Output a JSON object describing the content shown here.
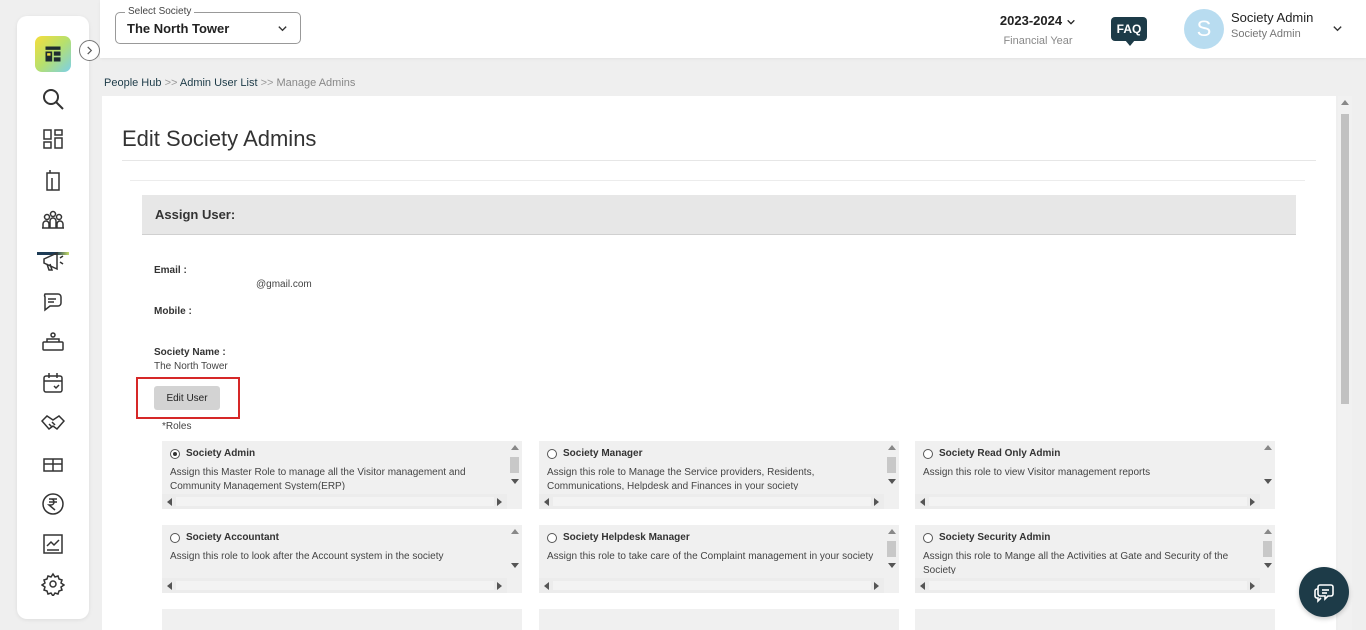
{
  "sidebar": {
    "nav_items": [
      "search-icon",
      "dashboard-icon",
      "building-icon",
      "people-icon",
      "megaphone-icon",
      "chat-icon",
      "amenity-icon",
      "calendar-icon",
      "handshake-icon",
      "gift-icon",
      "rupee-icon",
      "report-icon",
      "gear-icon"
    ],
    "active_item": "people-icon"
  },
  "header": {
    "society_select_label": "Select Society",
    "society_select_value": "The North Tower",
    "financial_year": "2023-2024",
    "financial_year_label": "Financial Year",
    "faq_label": "FAQ",
    "avatar_initial": "S",
    "user_name": "Society Admin",
    "user_role": "Society Admin"
  },
  "breadcrumb": {
    "item1": "People Hub",
    "item2": "Admin User List",
    "current": "Manage Admins",
    "separator": ">>"
  },
  "main": {
    "title": "Edit Society Admins",
    "section_title": "Assign User:",
    "email_label": "Email :",
    "email_value": "@gmail.com",
    "mobile_label": "Mobile :",
    "society_name_label": "Society Name :",
    "society_name_value": "The North Tower",
    "edit_user_label": "Edit User",
    "roles_label": "*Roles",
    "roles": [
      {
        "title": "Society Admin",
        "desc": "Assign this Master Role to manage all the Visitor management and Community Management System(ERP)",
        "selected": true
      },
      {
        "title": "Society Manager",
        "desc": "Assign this role to Manage the Service providers, Residents, Communications, Helpdesk and Finances in your society",
        "selected": false
      },
      {
        "title": "Society Read Only Admin",
        "desc": "Assign this role to view Visitor management reports",
        "selected": false
      },
      {
        "title": "Society Accountant",
        "desc": "Assign this role to look after the Account system in the society",
        "selected": false
      },
      {
        "title": "Society Helpdesk Manager",
        "desc": "Assign this role to take care of the Complaint management in your society",
        "selected": false
      },
      {
        "title": "Society Security Admin",
        "desc": "Assign this role to Mange all the Activities at Gate and Security of the Society",
        "selected": false
      }
    ]
  },
  "colors": {
    "brand_dark": "#1d3b48",
    "highlight": "#d62828"
  }
}
